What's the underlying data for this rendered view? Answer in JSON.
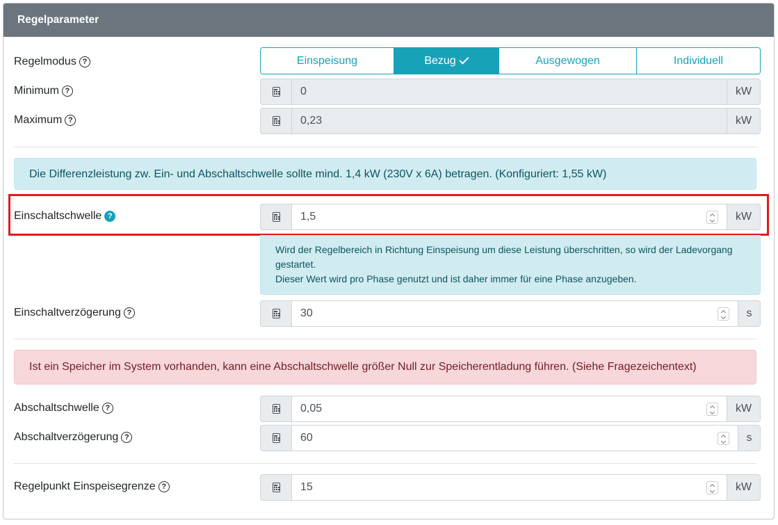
{
  "card": {
    "title": "Regelparameter"
  },
  "regelmodus": {
    "label": "Regelmodus",
    "options": [
      "Einspeisung",
      "Bezug",
      "Ausgewogen",
      "Individuell"
    ],
    "selected": "Bezug"
  },
  "minimum": {
    "label": "Minimum",
    "value": "0",
    "unit": "kW"
  },
  "maximum": {
    "label": "Maximum",
    "value": "0,23",
    "unit": "kW"
  },
  "info_differenz": "Die Differenzleistung zw. Ein- und Abschaltschwelle sollte mind. 1,4 kW (230V x 6A) betragen. (Konfiguriert: 1,55 kW)",
  "einschaltschwelle": {
    "label": "Einschaltschwelle",
    "value": "1,5",
    "unit": "kW",
    "help_line1": "Wird der Regelbereich in Richtung Einspeisung um diese Leistung überschritten, so wird der Ladevorgang gestartet.",
    "help_line2": "Dieser Wert wird pro Phase genutzt und ist daher immer für eine Phase anzugeben."
  },
  "einschaltverzoegerung": {
    "label": "Einschaltverzögerung",
    "value": "30",
    "unit": "s"
  },
  "warn_speicher": "Ist ein Speicher im System vorhanden, kann eine Abschaltschwelle größer Null zur Speicherentladung führen. (Siehe Fragezeichentext)",
  "abschaltschwelle": {
    "label": "Abschaltschwelle",
    "value": "0,05",
    "unit": "kW"
  },
  "abschaltverzoegerung": {
    "label": "Abschaltverzögerung",
    "value": "60",
    "unit": "s"
  },
  "regelpunkt": {
    "label": "Regelpunkt Einspeisegrenze",
    "value": "15",
    "unit": "kW"
  },
  "colors": {
    "header": "#6c757d",
    "accent": "#17a2b8",
    "highlight": "#e01b1b"
  },
  "icons": {
    "help": "question-circle-icon",
    "calculator": "calculator-icon"
  }
}
